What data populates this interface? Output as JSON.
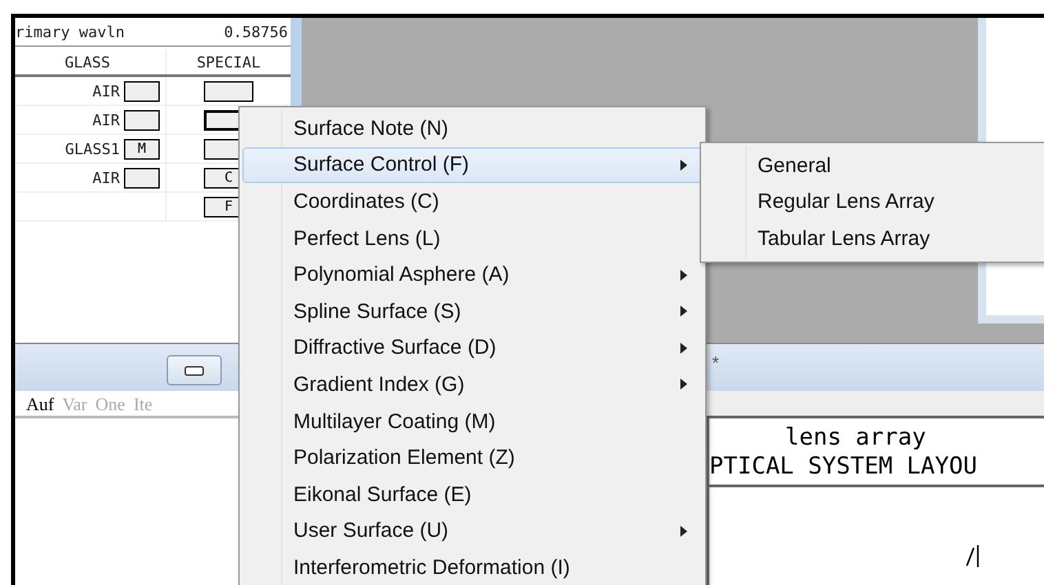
{
  "lens_table": {
    "wavelength_label": "rimary wavln",
    "wavelength_value": "0.58756",
    "columns": [
      "GLASS",
      "SPECIAL"
    ],
    "rows": [
      {
        "glass": "AIR",
        "glass_button": true,
        "special": "",
        "special_focused": false
      },
      {
        "glass": "AIR",
        "glass_button": true,
        "special_focused": true
      },
      {
        "glass": "GLASS1",
        "glass_button": true,
        "glass_solve": "M",
        "special_focused": false
      },
      {
        "glass": "AIR",
        "glass_button": true,
        "special": "C",
        "special_focused": false
      },
      {
        "glass_button": false,
        "special": "F",
        "special_focused": false
      }
    ]
  },
  "editor_tabs": [
    {
      "label": "Auf",
      "selected": true
    },
    {
      "label": "Var",
      "selected": false
    },
    {
      "label": "One",
      "selected": false
    },
    {
      "label": "Ite",
      "selected": false
    }
  ],
  "layout_window": {
    "title": "*",
    "plot_title": "lens array",
    "plot_subtitle": "PTICAL SYSTEM LAYOU"
  },
  "context_menu": [
    {
      "label": "Surface Note (N)",
      "submenu": false,
      "selected": false
    },
    {
      "label": "Surface Control (F)",
      "submenu": true,
      "selected": true
    },
    {
      "label": "Coordinates (C)",
      "submenu": false,
      "selected": false
    },
    {
      "label": "Perfect Lens (L)",
      "submenu": false,
      "selected": false
    },
    {
      "label": "Polynomial Asphere (A)",
      "submenu": true,
      "selected": false
    },
    {
      "label": "Spline Surface (S)",
      "submenu": true,
      "selected": false
    },
    {
      "label": "Diffractive Surface (D)",
      "submenu": true,
      "selected": false
    },
    {
      "label": "Gradient Index (G)",
      "submenu": true,
      "selected": false
    },
    {
      "label": "Multilayer Coating (M)",
      "submenu": false,
      "selected": false
    },
    {
      "label": "Polarization Element (Z)",
      "submenu": false,
      "selected": false
    },
    {
      "label": "Eikonal Surface (E)",
      "submenu": false,
      "selected": false
    },
    {
      "label": "User Surface (U)",
      "submenu": true,
      "selected": false
    },
    {
      "label": "Interferometric Deformation (I)",
      "submenu": false,
      "selected": false
    }
  ],
  "submenu": [
    {
      "label": "General"
    },
    {
      "label": "Regular Lens Array"
    },
    {
      "label": "Tabular Lens Array"
    }
  ]
}
